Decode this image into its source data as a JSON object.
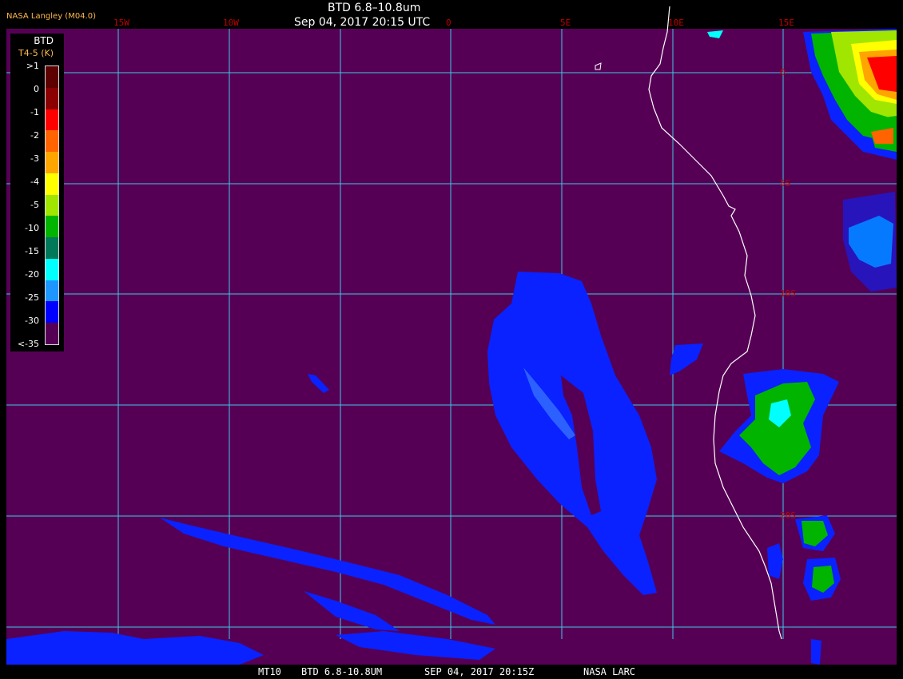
{
  "header": {
    "agency": "NASA Langley (M04.0)",
    "title": "BTD 6.8–10.8um",
    "datetime": "Sep 04, 2017 20:15 UTC"
  },
  "footer": {
    "satellite": "MT10",
    "product": "BTD 6.8-10.8UM",
    "datetime": "SEP 04, 2017 20:15Z",
    "source": "NASA LARC"
  },
  "grid": {
    "longitudes": [
      "15W",
      "10W",
      "0",
      "5E",
      "10E",
      "15E"
    ],
    "latitudes": [
      "0",
      "5S",
      "10S",
      "20S"
    ],
    "line_color": "#3fc8e6",
    "label_color": "#c00000"
  },
  "legend": {
    "title": "BTD",
    "subtitle": "T4-5 (K)",
    "labels": [
      ">1",
      "0",
      "-1",
      "-2",
      "-3",
      "-4",
      "-5",
      "-10",
      "-15",
      "-20",
      "-25",
      "-30",
      "<-35"
    ],
    "colors": [
      "#5c0000",
      "#8b0000",
      "#ff0000",
      "#ff6400",
      "#ffa500",
      "#ffff00",
      "#a0e600",
      "#00b400",
      "#00785a",
      "#00ffff",
      "#1e96ff",
      "#0000ff",
      "#560055"
    ]
  },
  "colors": {
    "background": "#560055",
    "coastline": "#ffffff",
    "smoke_plume": "#0a22ff"
  }
}
